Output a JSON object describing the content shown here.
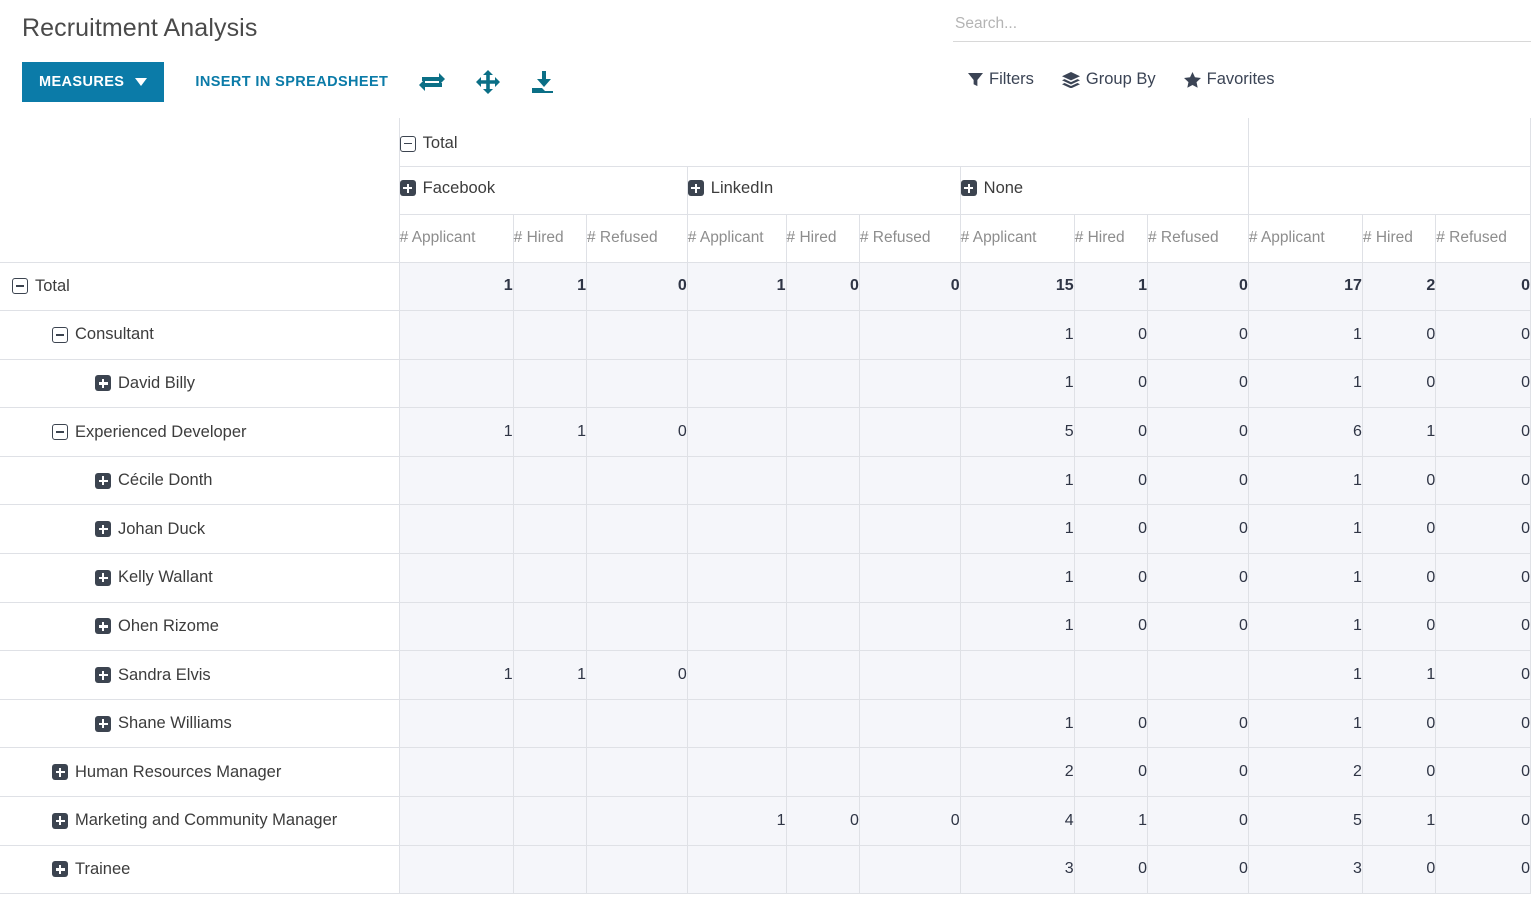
{
  "header": {
    "title": "Recruitment Analysis",
    "search": {
      "placeholder": "Search...",
      "value": ""
    },
    "measures_label": "MEASURES",
    "insert_label": "INSERT IN SPREADSHEET",
    "icons": [
      "flip-axis-icon",
      "expand-icon",
      "download-icon"
    ],
    "right_actions": [
      {
        "label": "Filters",
        "icon": "filter-icon"
      },
      {
        "label": "Group By",
        "icon": "layers-icon"
      },
      {
        "label": "Favorites",
        "icon": "star-icon"
      }
    ]
  },
  "table": {
    "col_root": {
      "label": "Total",
      "state": "expanded"
    },
    "col_groups": [
      {
        "label": "Facebook",
        "state": "collapsed"
      },
      {
        "label": "LinkedIn",
        "state": "collapsed"
      },
      {
        "label": "None",
        "state": "collapsed"
      },
      {
        "label": "",
        "state": "none"
      }
    ],
    "measures": [
      "# Applicant",
      "# Hired",
      "# Refused"
    ],
    "rows": [
      {
        "label": "Total",
        "icon": "minus",
        "indent": 0,
        "bold": true,
        "values": [
          "1",
          "1",
          "0",
          "1",
          "0",
          "0",
          "15",
          "1",
          "0",
          "17",
          "2",
          "0"
        ]
      },
      {
        "label": "Consultant",
        "icon": "minus",
        "indent": 1,
        "bold": false,
        "values": [
          "",
          "",
          "",
          "",
          "",
          "",
          "1",
          "0",
          "0",
          "1",
          "0",
          "0"
        ]
      },
      {
        "label": "David Billy",
        "icon": "plus",
        "indent": 2,
        "bold": false,
        "values": [
          "",
          "",
          "",
          "",
          "",
          "",
          "1",
          "0",
          "0",
          "1",
          "0",
          "0"
        ]
      },
      {
        "label": "Experienced Developer",
        "icon": "minus",
        "indent": 1,
        "bold": false,
        "values": [
          "1",
          "1",
          "0",
          "",
          "",
          "",
          "5",
          "0",
          "0",
          "6",
          "1",
          "0"
        ]
      },
      {
        "label": "Cécile Donth",
        "icon": "plus",
        "indent": 2,
        "bold": false,
        "values": [
          "",
          "",
          "",
          "",
          "",
          "",
          "1",
          "0",
          "0",
          "1",
          "0",
          "0"
        ]
      },
      {
        "label": "Johan Duck",
        "icon": "plus",
        "indent": 2,
        "bold": false,
        "values": [
          "",
          "",
          "",
          "",
          "",
          "",
          "1",
          "0",
          "0",
          "1",
          "0",
          "0"
        ]
      },
      {
        "label": "Kelly Wallant",
        "icon": "plus",
        "indent": 2,
        "bold": false,
        "values": [
          "",
          "",
          "",
          "",
          "",
          "",
          "1",
          "0",
          "0",
          "1",
          "0",
          "0"
        ]
      },
      {
        "label": "Ohen Rizome",
        "icon": "plus",
        "indent": 2,
        "bold": false,
        "values": [
          "",
          "",
          "",
          "",
          "",
          "",
          "1",
          "0",
          "0",
          "1",
          "0",
          "0"
        ]
      },
      {
        "label": "Sandra Elvis",
        "icon": "plus",
        "indent": 2,
        "bold": false,
        "values": [
          "1",
          "1",
          "0",
          "",
          "",
          "",
          "",
          "",
          "",
          "1",
          "1",
          "0"
        ]
      },
      {
        "label": "Shane Williams",
        "icon": "plus",
        "indent": 2,
        "bold": false,
        "values": [
          "",
          "",
          "",
          "",
          "",
          "",
          "1",
          "0",
          "0",
          "1",
          "0",
          "0"
        ]
      },
      {
        "label": "Human Resources Manager",
        "icon": "plus",
        "indent": 1,
        "bold": false,
        "values": [
          "",
          "",
          "",
          "",
          "",
          "",
          "2",
          "0",
          "0",
          "2",
          "0",
          "0"
        ]
      },
      {
        "label": "Marketing and Community Manager",
        "icon": "plus",
        "indent": 1,
        "bold": false,
        "values": [
          "",
          "",
          "",
          "1",
          "0",
          "0",
          "4",
          "1",
          "0",
          "5",
          "1",
          "0"
        ]
      },
      {
        "label": "Trainee",
        "icon": "plus",
        "indent": 1,
        "bold": false,
        "values": [
          "",
          "",
          "",
          "",
          "",
          "",
          "3",
          "0",
          "0",
          "3",
          "0",
          "0"
        ]
      }
    ]
  },
  "colors": {
    "accent": "#0b7ba8",
    "cell_bg": "#f5f6fa",
    "border": "#dfe1e6",
    "icon_dark": "#3c4450"
  }
}
